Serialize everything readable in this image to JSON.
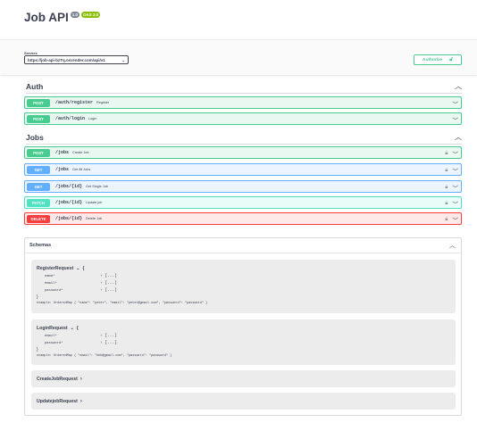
{
  "header": {
    "title": "Job API",
    "version_badge": "1.0",
    "oas_badge": "OAS 3.0"
  },
  "servers": {
    "label": "Servers",
    "selected": "https://job-api-bzTq.onrender.com/api/v1"
  },
  "authorize": {
    "label": "Authorize"
  },
  "sections": [
    {
      "name": "Auth",
      "operations": [
        {
          "method": "POST",
          "path": "/auth/register",
          "summary": "Register",
          "locked": false
        },
        {
          "method": "POST",
          "path": "/auth/login",
          "summary": "Login",
          "locked": false
        }
      ]
    },
    {
      "name": "Jobs",
      "operations": [
        {
          "method": "POST",
          "path": "/jobs",
          "summary": "Create Job",
          "locked": true
        },
        {
          "method": "GET",
          "path": "/jobs",
          "summary": "Get All Jobs",
          "locked": true
        },
        {
          "method": "GET",
          "path": "/jobs/{id}",
          "summary": "Get Single Job",
          "locked": true
        },
        {
          "method": "PATCH",
          "path": "/jobs/{id}",
          "summary": "Update job",
          "locked": true
        },
        {
          "method": "DELETE",
          "path": "/jobs/{id}",
          "summary": "Delete Job",
          "locked": true
        }
      ]
    }
  ],
  "schemas": {
    "title": "Schemas",
    "models": [
      {
        "name": "RegisterRequest",
        "open_brace": "{",
        "close_brace": "}",
        "properties": [
          {
            "name": "name*",
            "type": "[...]"
          },
          {
            "name": "email*",
            "type": "[...]"
          },
          {
            "name": "password*",
            "type": "[...]"
          }
        ],
        "example": "example: OrderedMap { \"name\": \"peter\", \"email\": \"peter@gmail.com\", \"password\": \"password\" }"
      },
      {
        "name": "LoginRequest",
        "open_brace": "{",
        "close_brace": "}",
        "properties": [
          {
            "name": "email*",
            "type": "[...]"
          },
          {
            "name": "password*",
            "type": "[...]"
          }
        ],
        "example": "example: OrderedMap { \"email\": \"bhb@gmail.com\", \"password\": \"password\" }"
      },
      {
        "name": "CreateJobRequest"
      },
      {
        "name": "UpdatejobRequest"
      }
    ]
  },
  "colors": {
    "post": "#49cc90",
    "get": "#61affe",
    "patch": "#50e3c2",
    "delete": "#f93e3e"
  },
  "icons": {
    "lock": "lock-icon",
    "chevron_down": "chevron-down-icon",
    "chevron_up": "chevron-up-icon",
    "chevron_right": "chevron-right-icon"
  }
}
